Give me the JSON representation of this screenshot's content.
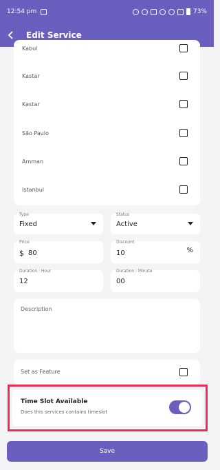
{
  "status_bar": {
    "time": "12:54 pm",
    "battery": "73%"
  },
  "app_bar": {
    "title": "Edit Service"
  },
  "cities": [
    {
      "label": "Kabul"
    },
    {
      "label": "Kastar"
    },
    {
      "label": "Kastar"
    },
    {
      "label": "São Paulo"
    },
    {
      "label": "Amman"
    },
    {
      "label": "Istanbul"
    }
  ],
  "form": {
    "type": {
      "label": "Type",
      "value": "Fixed"
    },
    "status": {
      "label": "Status",
      "value": "Active"
    },
    "price": {
      "label": "Price",
      "currency": "$",
      "value": "80"
    },
    "discount": {
      "label": "Discount",
      "value": "10",
      "suffix": "%"
    },
    "duration_hour": {
      "label": "Duration : Hour",
      "value": "12"
    },
    "duration_minute": {
      "label": "Duration : Minute",
      "value": "00"
    },
    "description": {
      "label": "Description"
    },
    "feature": {
      "label": "Set as Feature"
    }
  },
  "time_slot": {
    "title": "Time Slot Available",
    "subtitle": "Does this services contains timeslot",
    "enabled": true
  },
  "save_label": "Save"
}
